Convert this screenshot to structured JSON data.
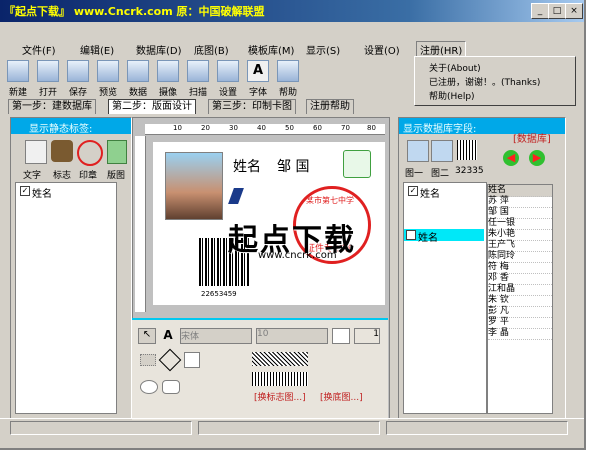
{
  "window": {
    "title": "『起点下载』 www.Cncrk.com 原：中国破解联盟",
    "controls": [
      "_",
      "□",
      "×"
    ]
  },
  "menu": {
    "items": [
      "文件(F)",
      "编辑(E)",
      "数据库(D)",
      "底图(B)",
      "模板库(M)",
      "显示(S)",
      "设置(O)",
      "注册(HR)"
    ],
    "dropdown": [
      "关于(About)",
      "已注册，谢谢！。(Thanks)",
      "帮助(Help)"
    ]
  },
  "toolbar": [
    "新建",
    "打开",
    "保存",
    "预览",
    "数据",
    "摄像",
    "扫描",
    "设置",
    "字体",
    "帮助"
  ],
  "steps": [
    "第一步：建数据库",
    "第二步：版面设计",
    "第三步：印制卡图",
    "注册帮助"
  ],
  "left_panel": {
    "header": "显示静态标签:",
    "tools": [
      "文字",
      "标志",
      "印章",
      "版图"
    ],
    "field": "姓名"
  },
  "card": {
    "name_label": "姓名",
    "name_value": "邹 国",
    "barcode": "22653459",
    "ruler_ticks": [
      "10",
      "20",
      "30",
      "40",
      "50",
      "60",
      "70",
      "80"
    ],
    "seal_text": "证件专用章",
    "seal_arc": "某市第七中学"
  },
  "drawbar": {
    "font": "宋体",
    "size": "10",
    "width": "1",
    "btn1": "[换标志图...]",
    "btn2": "[换底图...]"
  },
  "right_panel": {
    "header": "显示数据库字段:",
    "db_label": "[数据库]",
    "tools": [
      "图一",
      "图二",
      "32335"
    ],
    "fields_left": [
      "姓名",
      "姓名"
    ],
    "names": [
      "姓名",
      "苏 萍",
      "邹 国",
      "任一银",
      "朱小艳",
      "王产飞",
      "陈同玲",
      "符 梅",
      "邓 香",
      "江和晶",
      "朱 钦",
      "彭 凡",
      "罗 平",
      "李 晶"
    ]
  },
  "watermark": {
    "text": "起点下载",
    "url": "www.cncrk.com"
  }
}
